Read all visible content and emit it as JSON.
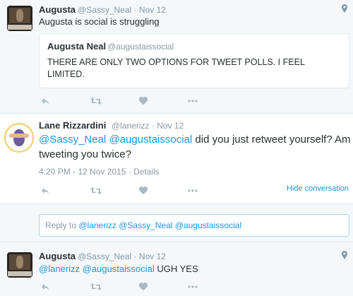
{
  "tweet1": {
    "avatar_alt": "Augusta avatar",
    "name": "Augusta",
    "handle": "@Sassy_Neal",
    "sep": "·",
    "date": "Nov 12",
    "text": "Augusta is social is struggling",
    "quoted": {
      "name": "Augusta Neal",
      "handle": "@augustaissocial",
      "text_line1": "THERE ARE ONLY TWO OPTIONS FOR TWEET POLLS. I FEEL",
      "text_line2": "LIMITED."
    }
  },
  "tweet2": {
    "name": "Lane Rizzardini",
    "handle": "@lanerizz",
    "sep": "·",
    "date": "Nov 12",
    "mention1": "@Sassy_Neal",
    "mention2": "@augustaissocial",
    "text_rest1": " did you just retweet yourself? Am I",
    "text_line2": "tweeting you twice?",
    "timestamp": "4:20 PM - 12 Nov 2015",
    "details_sep": "·",
    "details": "Details",
    "hide_conversation": "Hide conversation"
  },
  "reply_box": {
    "prefix": "Reply to ",
    "mentions": "@lanerizz @Sassy_Neal @augustaissocial"
  },
  "tweet3": {
    "name": "Augusta",
    "handle": "@Sassy_Neal",
    "sep": "·",
    "date": "Nov 12",
    "mention1": "@lanerizz",
    "mention2": "@augustaissocial",
    "text_rest": " UGH YES"
  },
  "icons": {
    "reply": "reply-icon",
    "retweet": "retweet-icon",
    "like": "heart-icon",
    "more": "more-icon",
    "location": "location-icon"
  },
  "colors": {
    "link": "#1b95e0",
    "muted": "#8899a6",
    "text": "#292f33",
    "background_alt": "#f5f8fa"
  }
}
